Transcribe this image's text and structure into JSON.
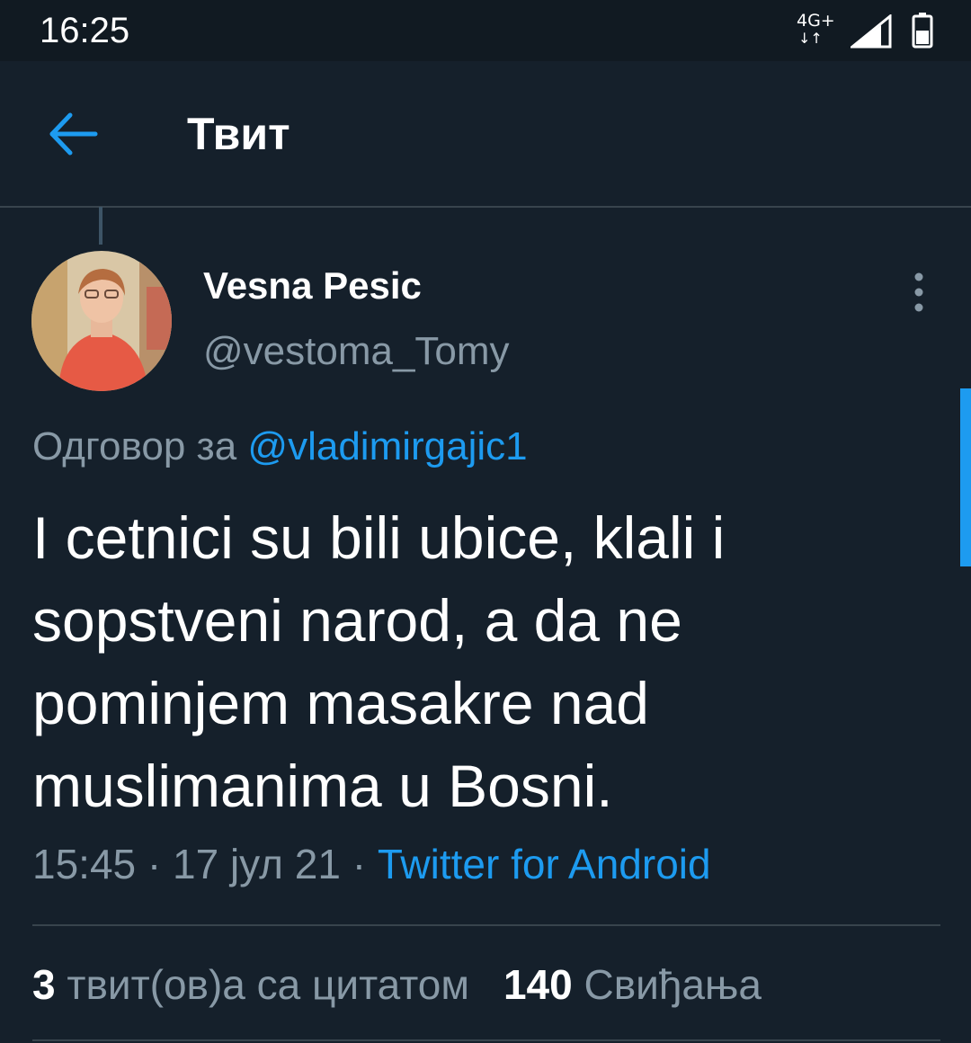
{
  "status_bar": {
    "time": "16:25",
    "network": "4G+",
    "network_arrows": "↓↑",
    "signal_icon": "signal-icon",
    "battery_icon": "battery-icon"
  },
  "header": {
    "back_icon": "back-arrow-icon",
    "title": "Твит"
  },
  "tweet": {
    "avatar_icon": "user-avatar",
    "display_name": "Vesna Pesic",
    "username": "@vestoma_Tomy",
    "more_icon": "more-vertical-icon",
    "reply_prefix": "Одговор за ",
    "reply_to": "@vladimirgajic1",
    "text": "I cetnici su bili ubice, klali i sopstveni narod, a da ne pominjem masakre nad muslimanima u Bosni.",
    "time": "15:45",
    "date": "17 јул 21",
    "separator": " · ",
    "source": "Twitter for Android"
  },
  "stats": {
    "quote_count": "3",
    "quote_label": " твит(ов)а са цитатом",
    "like_count": "140",
    "like_label": " Свиђања"
  },
  "colors": {
    "background": "#15202b",
    "status_bar": "#111a22",
    "accent": "#1d9bf0",
    "secondary_text": "#8899a6",
    "divider": "#38444d"
  }
}
